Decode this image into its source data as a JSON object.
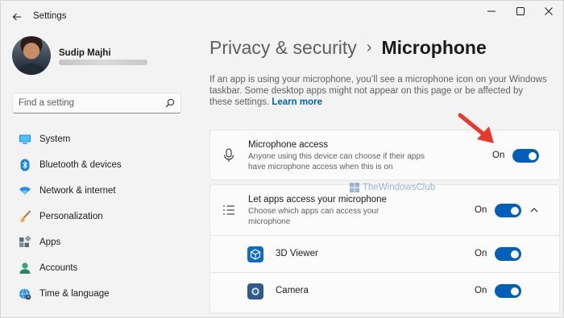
{
  "window": {
    "title": "Settings",
    "controls": [
      "minimize-icon",
      "maximize-icon",
      "close-icon"
    ]
  },
  "user": {
    "name": "Sudip Majhi"
  },
  "search": {
    "placeholder": "Find a setting"
  },
  "sidebar": {
    "items": [
      {
        "label": "System",
        "icon": "monitor-icon"
      },
      {
        "label": "Bluetooth & devices",
        "icon": "bluetooth-icon"
      },
      {
        "label": "Network & internet",
        "icon": "wifi-icon"
      },
      {
        "label": "Personalization",
        "icon": "paintbrush-icon"
      },
      {
        "label": "Apps",
        "icon": "apps-grid-icon"
      },
      {
        "label": "Accounts",
        "icon": "person-icon"
      },
      {
        "label": "Time & language",
        "icon": "globe-clock-icon"
      }
    ]
  },
  "main": {
    "breadcrumb_parent": "Privacy & security",
    "breadcrumb_separator": "›",
    "page_title": "Microphone",
    "description": "If an app is using your microphone, you’ll see a microphone icon on your Windows taskbar. Some desktop apps might not appear on this page or be affected by these settings.",
    "learn_more": "Learn more",
    "microphone_access": {
      "title": "Microphone access",
      "subtitle": "Anyone using this device can choose if their apps have microphone access when this is on",
      "state": "On",
      "enabled": true
    },
    "let_apps": {
      "title": "Let apps access your microphone",
      "subtitle": "Choose which apps can access your microphone",
      "state": "On",
      "enabled": true,
      "expanded": true
    },
    "apps": [
      {
        "name": "3D Viewer",
        "state": "On",
        "enabled": true,
        "icon": "cube-icon"
      },
      {
        "name": "Camera",
        "state": "On",
        "enabled": true,
        "icon": "camera-icon"
      }
    ]
  },
  "watermark": {
    "text": "TheWindowsClub"
  },
  "colors": {
    "accent": "#005fb8",
    "window_bg": "#f3f3f3",
    "card_bg": "#fbfbfb",
    "annotation_arrow": "#e8392b"
  }
}
